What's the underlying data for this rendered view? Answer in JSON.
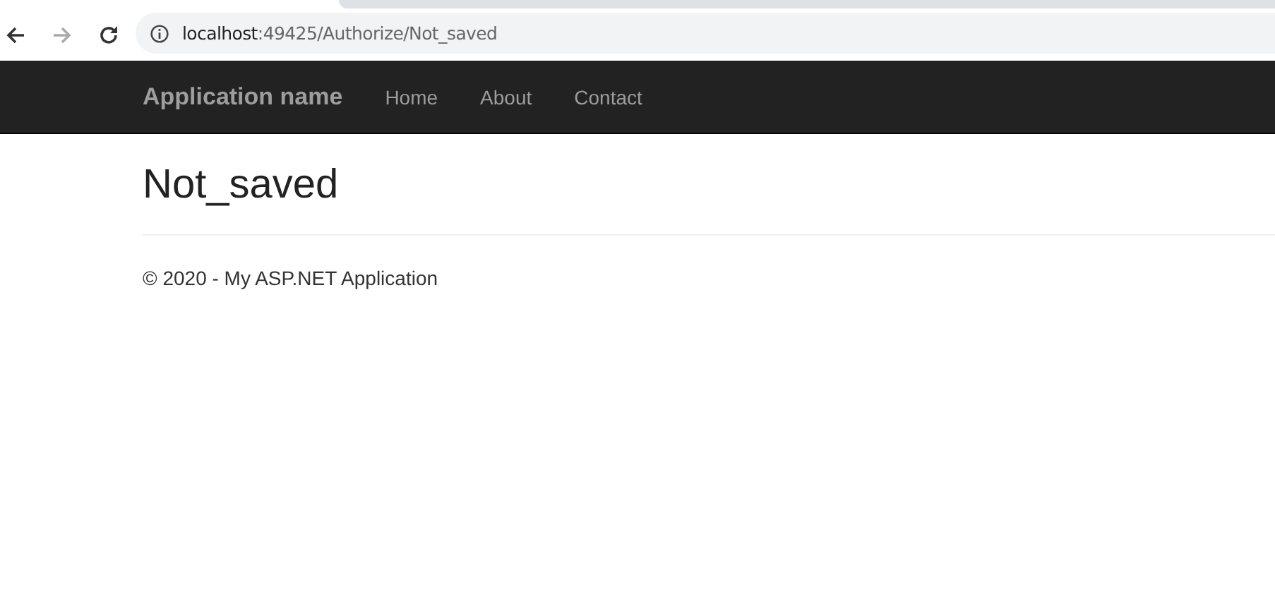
{
  "browser": {
    "back": {
      "disabled": false
    },
    "forward": {
      "disabled": true
    },
    "url": {
      "host": "localhost",
      "rest": ":49425/Authorize/Not_saved"
    }
  },
  "navbar": {
    "brand": "Application name",
    "links": [
      "Home",
      "About",
      "Contact"
    ]
  },
  "page": {
    "heading": "Not_saved",
    "footer": "© 2020 - My ASP.NET Application"
  }
}
